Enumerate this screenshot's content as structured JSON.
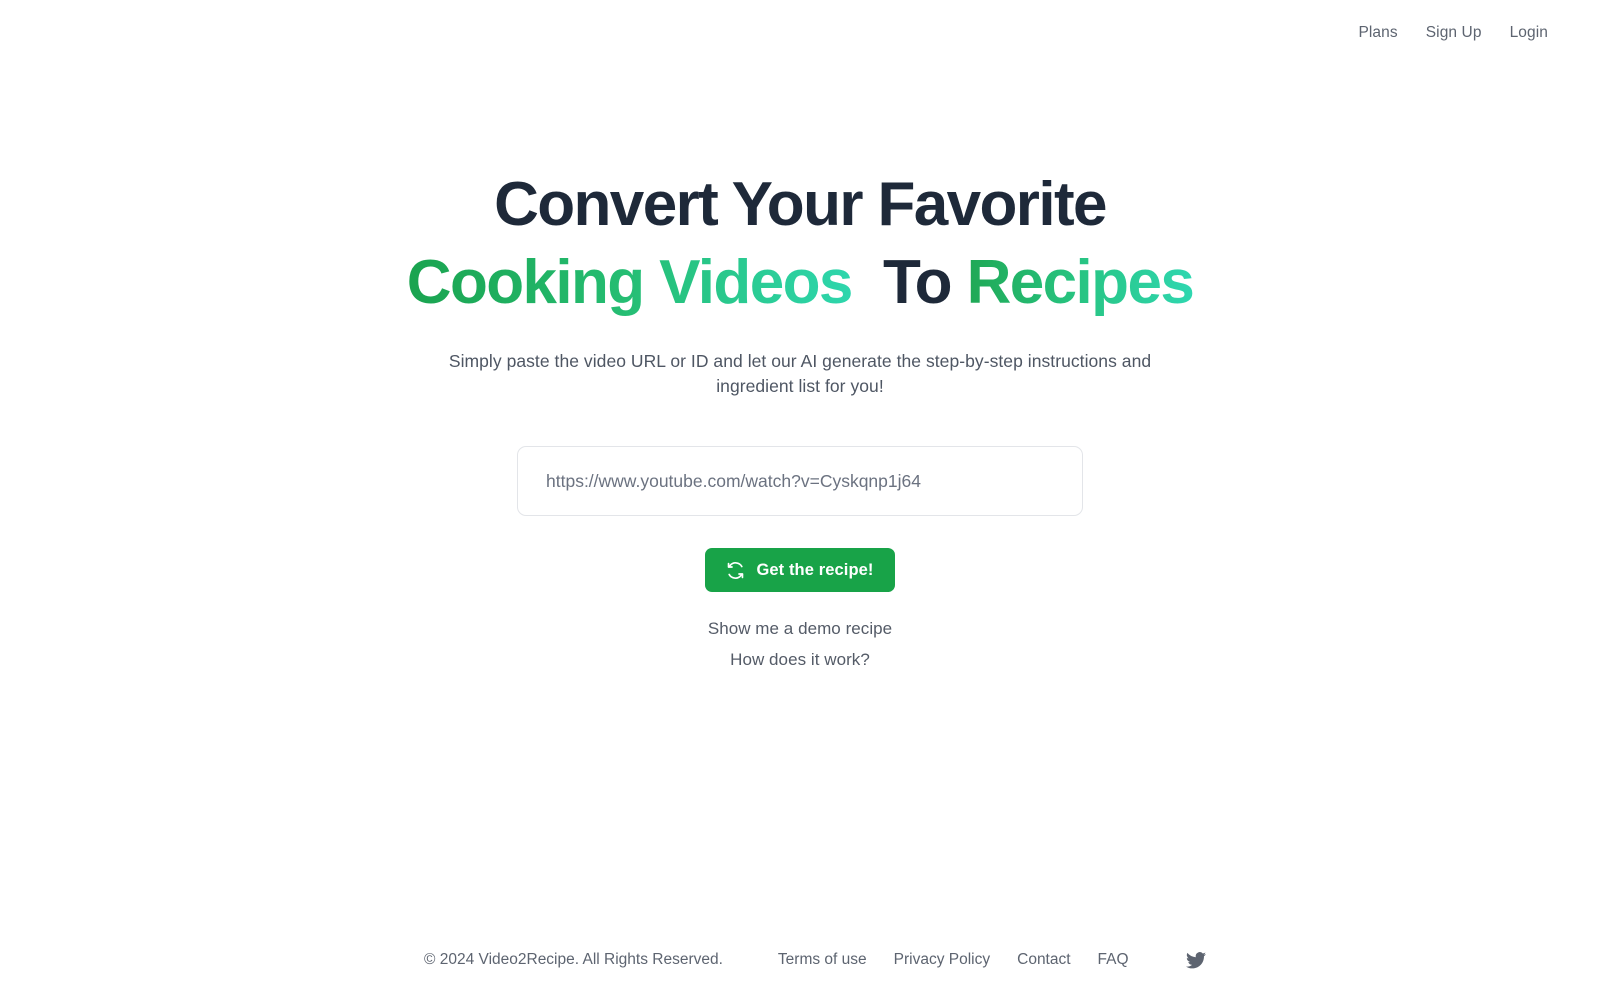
{
  "nav": {
    "links": [
      {
        "label": "Plans",
        "name": "nav-link-plans"
      },
      {
        "label": "Sign Up",
        "name": "nav-link-signup"
      },
      {
        "label": "Login",
        "name": "nav-link-login"
      }
    ]
  },
  "hero": {
    "headline": {
      "line1": "Convert Your Favorite",
      "line2_part1": "Cooking Videos",
      "line2_part2": "To",
      "line2_part3": "Recipes"
    },
    "subtitle": "Simply paste the video URL or ID and let our AI generate the step-by-step instructions and ingredient list for you!",
    "input": {
      "value": "",
      "placeholder": "https://www.youtube.com/watch?v=Cyskqnp1j64"
    },
    "cta": {
      "label": "Get the recipe!",
      "icon": "refresh-icon"
    },
    "secondary_links": [
      {
        "label": "Show me a demo recipe",
        "name": "demo-recipe-link"
      },
      {
        "label": "How does it work?",
        "name": "how-it-works-link"
      }
    ]
  },
  "footer": {
    "copyright": "© 2024 Video2Recipe. All Rights Reserved.",
    "links": [
      {
        "label": "Terms of use",
        "name": "footer-link-terms"
      },
      {
        "label": "Privacy Policy",
        "name": "footer-link-privacy"
      },
      {
        "label": "Contact",
        "name": "footer-link-contact"
      },
      {
        "label": "FAQ",
        "name": "footer-link-faq"
      }
    ],
    "social": [
      {
        "name": "twitter-icon"
      }
    ]
  },
  "colors": {
    "brand_green": "#18a348",
    "gradient_start": "#1aa34f",
    "gradient_end": "#2ed6ad",
    "heading_dark": "#1e2939",
    "body_text": "#4e5663",
    "muted_text": "#5d6470",
    "border": "#e3e5e9",
    "background": "#ffffff"
  }
}
